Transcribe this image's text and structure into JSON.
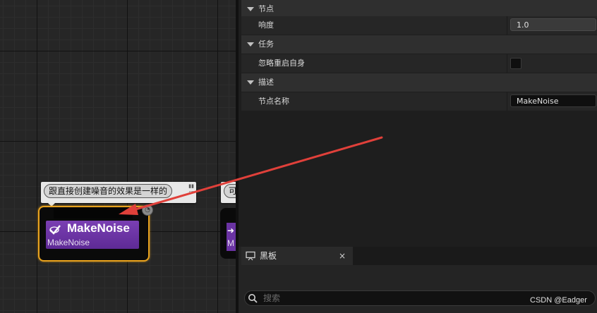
{
  "graph": {
    "comment_text": "跟直接创建噪音的效果是一样的",
    "comment2_text": "可",
    "node": {
      "title": "MakeNoise",
      "subtitle": "MakeNoise"
    },
    "node2": {
      "subtitle_initial": "M"
    }
  },
  "details": {
    "categories": [
      {
        "label": "节点",
        "rows": [
          {
            "label": "响度",
            "value": "1.0"
          }
        ]
      },
      {
        "label": "任务",
        "rows": [
          {
            "label": "忽略重启自身",
            "checked": false
          }
        ]
      },
      {
        "label": "描述",
        "rows": [
          {
            "label": "节点名称",
            "value": "MakeNoise"
          }
        ]
      }
    ]
  },
  "blackboard": {
    "tab_label": "黑板",
    "close_glyph": "×",
    "search_placeholder": "搜索"
  },
  "watermark": "CSDN @Eadger",
  "colors": {
    "node_purple": "#6a33a3",
    "selection_orange": "#e8a21e",
    "annotation_arrow": "#e0403a"
  }
}
